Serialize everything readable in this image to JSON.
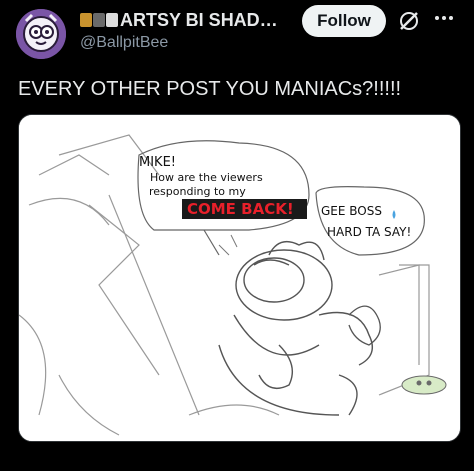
{
  "post": {
    "display_name": "ARTSY BI SHAD…",
    "handle": "@BallpitBee",
    "follow_label": "Follow",
    "text": "EVERY OTHER POST YOU MANIACs?!!!!!",
    "icons": {
      "avatar": "avatar",
      "grok": "grok-icon",
      "more": "more-icon"
    }
  },
  "comic": {
    "bubble_left": [
      "MIKE!",
      "How are the viewers",
      "responding to my"
    ],
    "highlight": "COME BACK!",
    "bubble_right": [
      "GEE BOSS",
      "HARD TA SAY!"
    ]
  },
  "colors": {
    "background": "#000000",
    "follow_bg": "#eff3f4",
    "highlight_bg": "#1a1a1a",
    "highlight_text": "#e8202a",
    "handle": "#8b98a5"
  }
}
